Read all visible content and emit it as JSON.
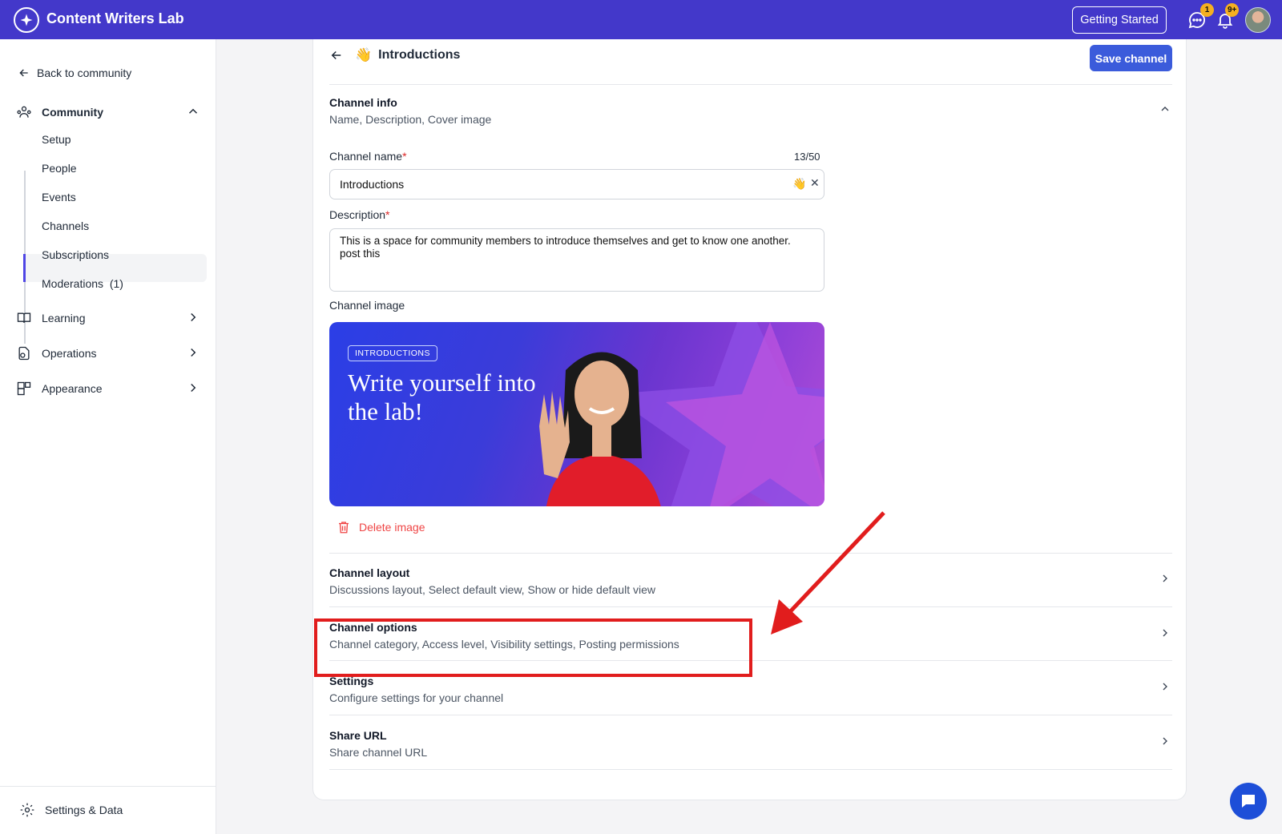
{
  "app": {
    "title": "Content Writers Lab",
    "getting_started": "Getting Started",
    "messages_badge": "1",
    "notifications_badge": "9+"
  },
  "sidebar": {
    "back": "Back to community",
    "community": "Community",
    "sub_items": [
      "Setup",
      "People",
      "Events",
      "Channels",
      "Subscriptions",
      "Moderations  (1)"
    ],
    "learning": "Learning",
    "operations": "Operations",
    "appearance": "Appearance",
    "settings": "Settings & Data"
  },
  "page": {
    "emoji": "👋",
    "title": "Introductions",
    "save": "Save channel"
  },
  "channel_info": {
    "title": "Channel info",
    "subtitle": "Name, Description, Cover image",
    "name_label": "Channel name",
    "name_counter": "13/50",
    "name_value": "Introductions",
    "desc_label": "Description",
    "desc_value": "This is a space for community members to introduce themselves and get to know one another. post this",
    "image_label": "Channel image",
    "cover_tag": "INTRODUCTIONS",
    "cover_headline": "Write yourself into the lab!",
    "delete_image": "Delete image"
  },
  "sections": [
    {
      "title": "Channel layout",
      "subtitle": "Discussions layout, Select default view, Show or hide default view"
    },
    {
      "title": "Channel options",
      "subtitle": "Channel category, Access level, Visibility settings, Posting permissions"
    },
    {
      "title": "Settings",
      "subtitle": "Configure settings for your channel"
    },
    {
      "title": "Share URL",
      "subtitle": "Share channel URL"
    }
  ],
  "colors": {
    "topbar": "#4338ca",
    "primary": "#3b5bdb",
    "danger": "#ef4444",
    "annotation": "#e11d1d"
  }
}
